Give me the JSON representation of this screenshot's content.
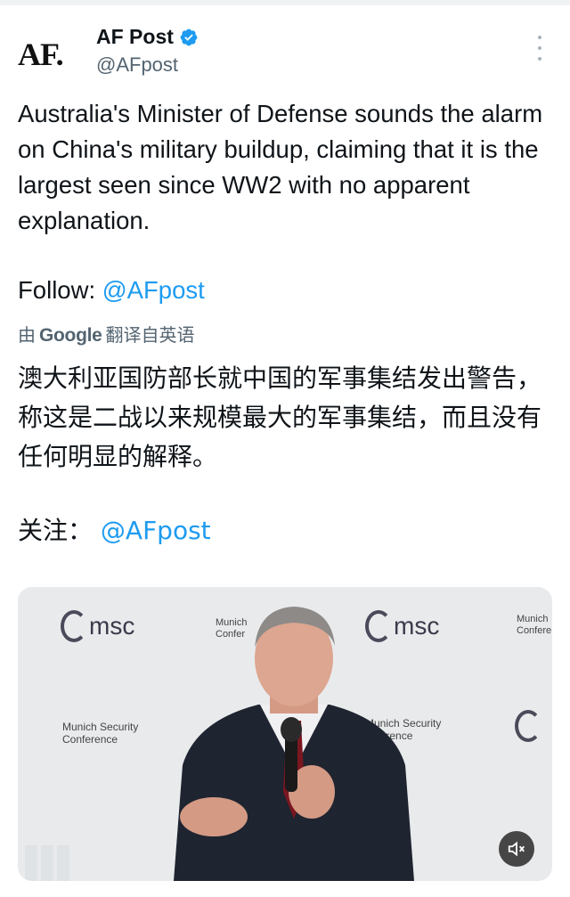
{
  "tweet": {
    "avatar_text": "AF.",
    "display_name": "AF Post",
    "handle": "@AFpost",
    "text": "Australia's Minister of Defense sounds the alarm on China's military buildup, claiming that it is the largest seen since WW2 with no apparent explanation.",
    "follow_label": "Follow:",
    "follow_mention": "@AFpost",
    "translation": {
      "prefix": "由",
      "brand": "Google",
      "suffix": "翻译自英语"
    },
    "translated_text": "澳大利亚国防部长就中国的军事集结发出警告，称这是二战以来规模最大的军事集结，而且没有任何明显的解释。",
    "translated_follow_label": "关注：",
    "translated_follow_mention": "@AFpost"
  },
  "media": {
    "backdrop": {
      "logo_text": "msc",
      "munich_short": "Munich",
      "conference_short": "Confer",
      "munich_security": "Munich Security",
      "conference": "Conference",
      "munich_security_cut": "Munich Security",
      "conference_cut": "onference",
      "munich_right": "Munich",
      "conference_right": "Confere"
    },
    "mute_icon": "speaker-muted-icon"
  },
  "colors": {
    "link": "#1d9bf0",
    "secondary_text": "#536471",
    "verified": "#1d9bf0"
  }
}
